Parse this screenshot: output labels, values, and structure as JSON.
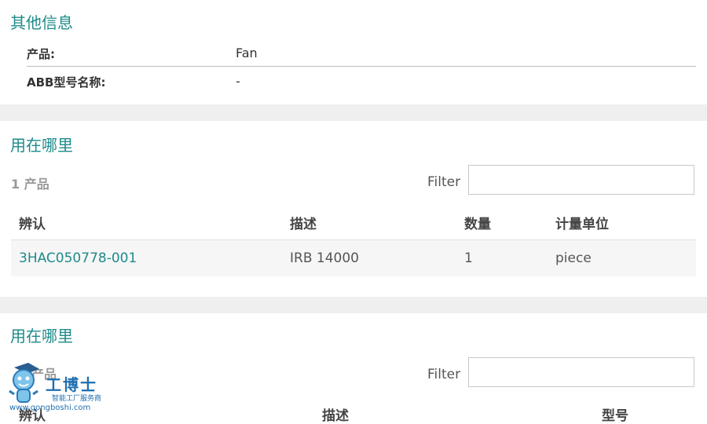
{
  "other_info": {
    "title": "其他信息",
    "rows": [
      {
        "label": "产品:",
        "value": "Fan"
      },
      {
        "label": "ABB型号名称:",
        "value": "-"
      }
    ]
  },
  "where_used_1": {
    "title": "用在哪里",
    "count": "1 产品",
    "filter_label": "Filter",
    "filter_value": "",
    "columns": [
      "辨认",
      "描述",
      "数量",
      "计量单位"
    ],
    "rows": [
      {
        "id": "3HAC050778-001",
        "desc": "IRB 14000",
        "qty": "1",
        "unit": "piece"
      }
    ]
  },
  "where_used_2": {
    "title": "用在哪里",
    "count": "产品",
    "filter_label": "Filter",
    "filter_value": "",
    "columns": [
      "辨认",
      "描述",
      "型号"
    ]
  },
  "watermark": {
    "brand": "工博士",
    "tagline": "智能工厂服务商",
    "url": "www.gongboshi.com"
  }
}
